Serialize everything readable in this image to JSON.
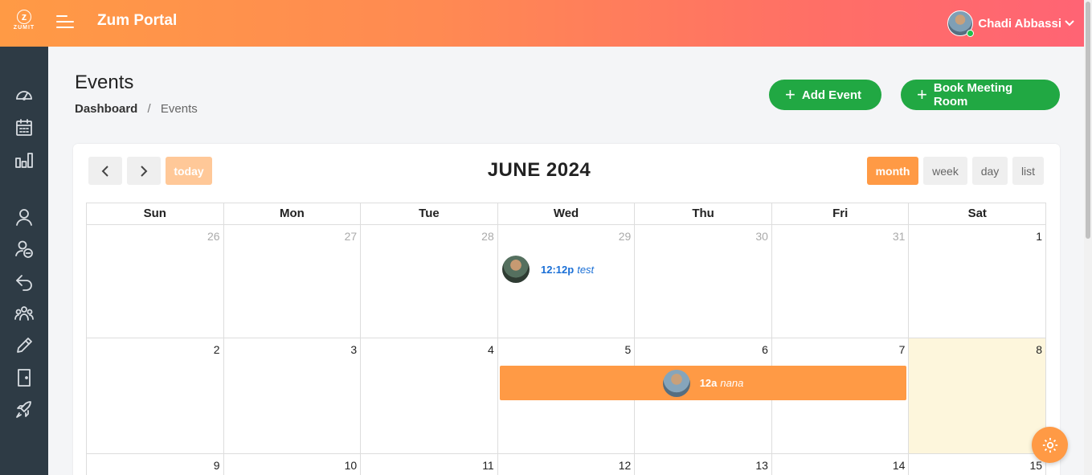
{
  "header": {
    "logo_text": "ZUMIT",
    "app_title": "Zum Portal",
    "user_name": "Chadi Abbassi",
    "user_status_color": "#1fbf4a",
    "gradient": [
      "#ff9a45",
      "#ff6474"
    ]
  },
  "sidebar": {
    "items": [
      {
        "icon": "dashboard-gauge-icon"
      },
      {
        "icon": "calendar-icon"
      },
      {
        "icon": "bar-chart-icon"
      },
      {
        "icon": "user-icon"
      },
      {
        "icon": "user-minus-icon"
      },
      {
        "icon": "undo-arrow-icon"
      },
      {
        "icon": "team-icon"
      },
      {
        "icon": "pencil-icon"
      },
      {
        "icon": "door-exit-icon"
      },
      {
        "icon": "rocket-icon"
      }
    ]
  },
  "page": {
    "title": "Events",
    "breadcrumb": {
      "home": "Dashboard",
      "separator": "/",
      "current": "Events"
    },
    "actions": {
      "add_event": "Add Event",
      "book_room": "Book Meeting Room",
      "plus": "+"
    }
  },
  "calendar": {
    "title": "JUNE 2024",
    "today_label": "today",
    "prev_icon": "‹",
    "next_icon": "›",
    "views": {
      "month": "month",
      "week": "week",
      "day": "day",
      "list": "list"
    },
    "active_view": "month",
    "days_of_week": [
      "Sun",
      "Mon",
      "Tue",
      "Wed",
      "Thu",
      "Fri",
      "Sat"
    ],
    "weeks": [
      [
        {
          "n": "26",
          "other": true
        },
        {
          "n": "27",
          "other": true
        },
        {
          "n": "28",
          "other": true
        },
        {
          "n": "29",
          "other": true
        },
        {
          "n": "30",
          "other": true
        },
        {
          "n": "31",
          "other": true
        },
        {
          "n": "1"
        }
      ],
      [
        {
          "n": "2"
        },
        {
          "n": "3"
        },
        {
          "n": "4"
        },
        {
          "n": "5"
        },
        {
          "n": "6"
        },
        {
          "n": "7"
        },
        {
          "n": "8",
          "today": true
        }
      ],
      [
        {
          "n": "9"
        },
        {
          "n": "10"
        },
        {
          "n": "11"
        },
        {
          "n": "12"
        },
        {
          "n": "13"
        },
        {
          "n": "14"
        },
        {
          "n": "15"
        }
      ]
    ],
    "events": [
      {
        "time": "12:12p",
        "name": "test",
        "day": "29"
      },
      {
        "time": "12a",
        "name": "nana",
        "start_day": "5",
        "end_day": "7"
      }
    ],
    "accent": "#ff9a45",
    "today_bg": "#fdf6dc"
  }
}
